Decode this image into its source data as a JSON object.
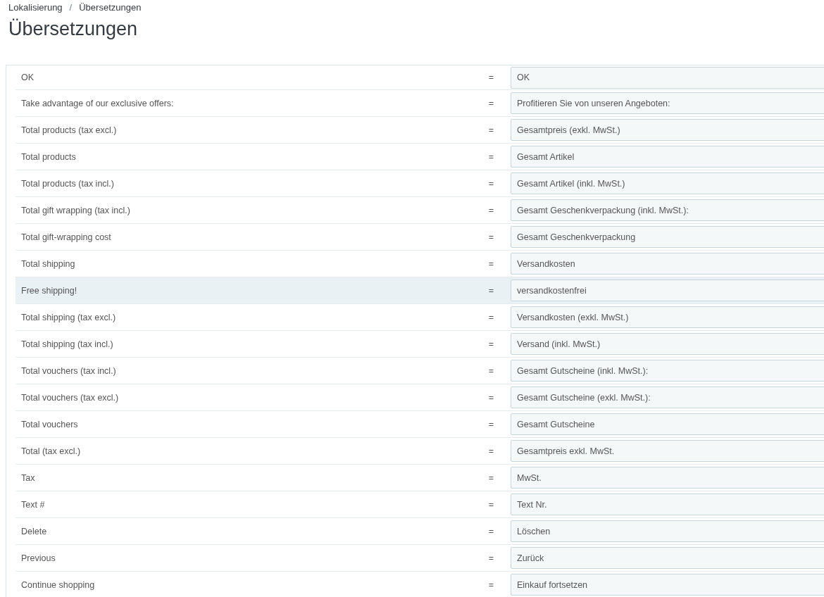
{
  "breadcrumb": [
    {
      "label": "Lokalisierung"
    },
    {
      "label": "Übersetzungen"
    }
  ],
  "breadcrumb_separator": "/",
  "title": "Übersetzungen",
  "rows": [
    {
      "source": "OK",
      "equals": "=",
      "translation": "OK",
      "highlighted": false
    },
    {
      "source": "Take advantage of our exclusive offers:",
      "equals": "=",
      "translation": "Profitieren Sie von unseren Angeboten:",
      "highlighted": false
    },
    {
      "source": "Total products (tax excl.)",
      "equals": "=",
      "translation": "Gesamtpreis (exkl. MwSt.)",
      "highlighted": false
    },
    {
      "source": "Total products",
      "equals": "=",
      "translation": "Gesamt Artikel",
      "highlighted": false
    },
    {
      "source": "Total products (tax incl.)",
      "equals": "=",
      "translation": "Gesamt Artikel (inkl. MwSt.)",
      "highlighted": false
    },
    {
      "source": "Total gift wrapping (tax incl.)",
      "equals": "=",
      "translation": "Gesamt Geschenkverpackung (inkl. MwSt.):",
      "highlighted": false
    },
    {
      "source": "Total gift-wrapping cost",
      "equals": "=",
      "translation": "Gesamt Geschenkverpackung",
      "highlighted": false
    },
    {
      "source": "Total shipping",
      "equals": "=",
      "translation": "Versandkosten",
      "highlighted": false
    },
    {
      "source": "Free shipping!",
      "equals": "=",
      "translation": "versandkostenfrei",
      "highlighted": true
    },
    {
      "source": "Total shipping (tax excl.)",
      "equals": "=",
      "translation": "Versandkosten (exkl. MwSt.)",
      "highlighted": false
    },
    {
      "source": "Total shipping (tax incl.)",
      "equals": "=",
      "translation": "Versand (inkl. MwSt.)",
      "highlighted": false
    },
    {
      "source": "Total vouchers (tax incl.)",
      "equals": "=",
      "translation": "Gesamt Gutscheine (inkl. MwSt.):",
      "highlighted": false
    },
    {
      "source": "Total vouchers (tax excl.)",
      "equals": "=",
      "translation": "Gesamt Gutscheine (exkl. MwSt.):",
      "highlighted": false
    },
    {
      "source": "Total vouchers",
      "equals": "=",
      "translation": "Gesamt Gutscheine",
      "highlighted": false
    },
    {
      "source": "Total (tax excl.)",
      "equals": "=",
      "translation": "Gesamtpreis exkl. MwSt.",
      "highlighted": false
    },
    {
      "source": "Tax",
      "equals": "=",
      "translation": "MwSt.",
      "highlighted": false
    },
    {
      "source": "Text #",
      "equals": "=",
      "translation": "Text Nr.",
      "highlighted": false
    },
    {
      "source": "Delete",
      "equals": "=",
      "translation": "Löschen",
      "highlighted": false
    },
    {
      "source": "Previous",
      "equals": "=",
      "translation": "Zurück",
      "highlighted": false
    },
    {
      "source": "Continue shopping",
      "equals": "=",
      "translation": "Einkauf fortsetzen",
      "highlighted": false
    }
  ]
}
